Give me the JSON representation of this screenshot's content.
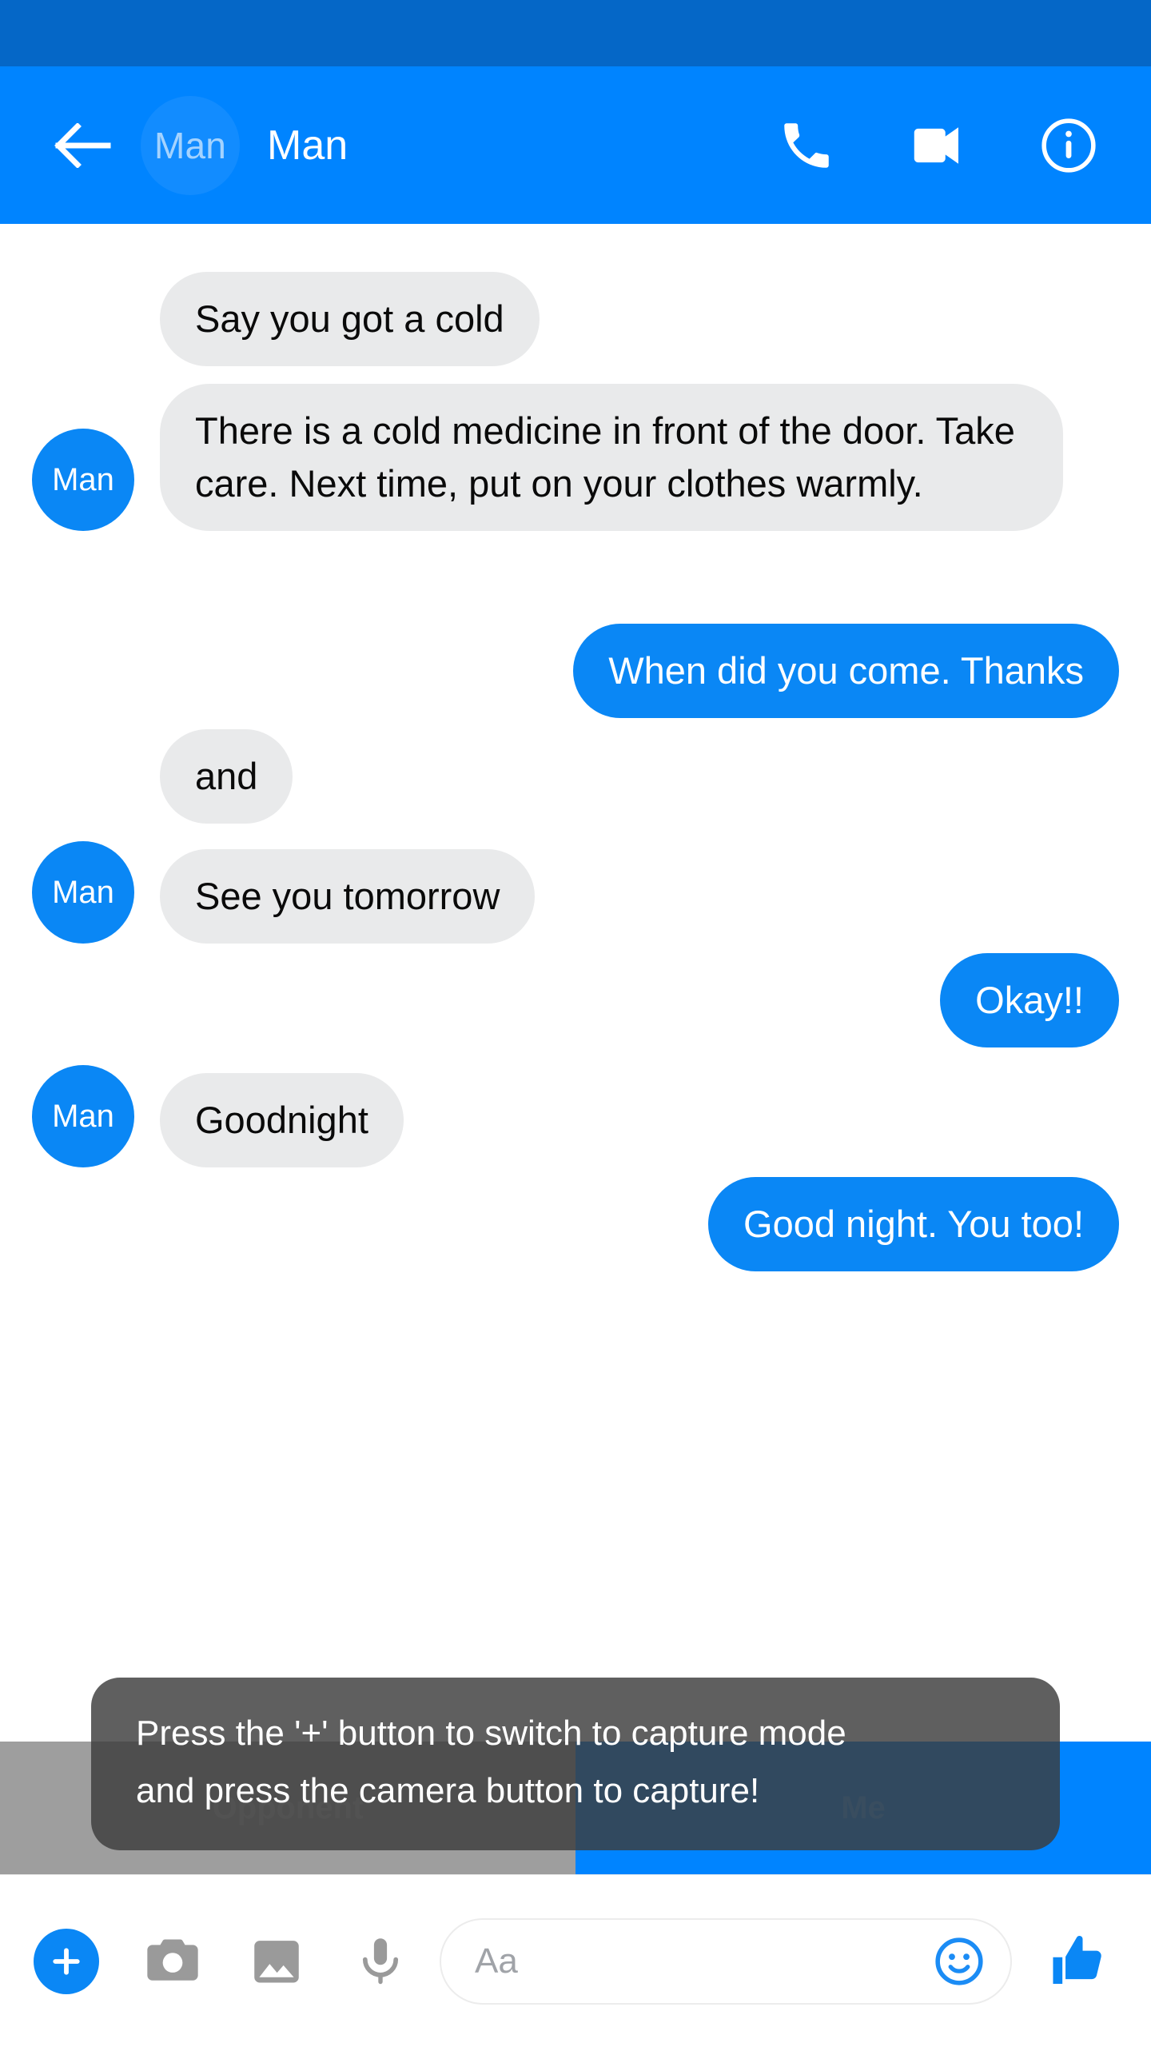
{
  "app": {
    "accent_blue": "#0084FF",
    "status_bar_blue": "#0567C7",
    "bubble_in_bg": "#E9EAEB",
    "bubble_out_bg": "#0A87F5"
  },
  "header": {
    "back_icon": "back-arrow-icon",
    "avatar_label": "Man",
    "title": "Man",
    "actions": [
      {
        "name": "voice-call-button",
        "icon": "phone-icon"
      },
      {
        "name": "video-call-button",
        "icon": "video-camera-icon"
      },
      {
        "name": "conversation-info-button",
        "icon": "info-circle-icon"
      }
    ]
  },
  "thread": {
    "avatar_label": "Man",
    "messages": [
      {
        "id": 1,
        "side": "in",
        "text": "Say you got a cold",
        "avatar": false
      },
      {
        "id": 2,
        "side": "in",
        "text": "There is a cold medicine in front of the door. Take care. Next time, put on your clothes warmly.",
        "avatar": true
      },
      {
        "id": 3,
        "side": "out",
        "text": "When did you come. Thanks"
      },
      {
        "id": 4,
        "side": "in",
        "text": "and",
        "avatar": false
      },
      {
        "id": 5,
        "side": "in",
        "text": "See you tomorrow",
        "avatar": true
      },
      {
        "id": 6,
        "side": "out",
        "text": "Okay!!"
      },
      {
        "id": 7,
        "side": "in",
        "text": "Goodnight",
        "avatar": true
      },
      {
        "id": 8,
        "side": "out",
        "text": "Good night. You too!"
      }
    ]
  },
  "turn_bar": {
    "opponent_label": "Opponent",
    "me_label": "Me",
    "opponent_color": "#9E9E9E",
    "me_color": "#0084FF"
  },
  "toast": {
    "line1": "Press the '+' button to switch to capture mode",
    "line2": "and press the camera button to capture!"
  },
  "composer": {
    "plus_icon": "plus-icon",
    "camera_icon": "camera-icon",
    "gallery_icon": "image-icon",
    "mic_icon": "microphone-icon",
    "input_placeholder": "Aa",
    "input_value": "",
    "emoji_icon": "smiley-icon",
    "like_icon": "thumbs-up-icon"
  }
}
